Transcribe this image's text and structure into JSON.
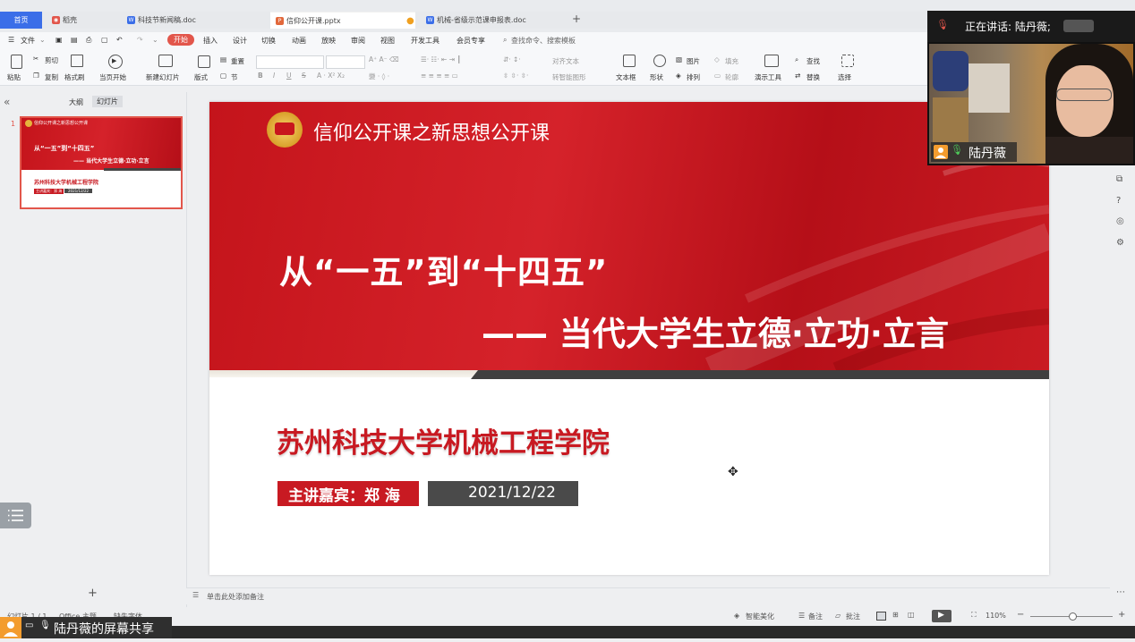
{
  "tabs": {
    "home": "首页",
    "t1": "稻壳",
    "t2": "科技节新闻稿.doc",
    "t3": "信仰公开课.pptx",
    "t4": "机械-省级示范课申报表.doc",
    "add": "+"
  },
  "menu": {
    "file": "文件",
    "items": [
      "开始",
      "插入",
      "设计",
      "切换",
      "动画",
      "放映",
      "审阅",
      "视图",
      "开发工具",
      "会员专享"
    ],
    "search": "查找命令、搜索模板"
  },
  "ribbon": {
    "paste": "粘贴",
    "cut": "剪切",
    "copy": "复制",
    "format_painter": "格式刷",
    "from_start": "当页开始",
    "new_slide": "新建幻灯片",
    "layout": "版式",
    "section": "节",
    "reset": "重置",
    "align_text": "对齐文本",
    "smartart": "转智能图形",
    "textbox": "文本框",
    "shape": "形状",
    "picture": "图片",
    "fill": "填充",
    "arrange": "排列",
    "outline": "轮廓",
    "present_tools": "演示工具",
    "find": "查找",
    "replace": "替换",
    "select": "选择"
  },
  "panel": {
    "collapse": "«",
    "outline_tab": "大纲",
    "slides_tab": "幻灯片",
    "slide_number": "1",
    "add": "+"
  },
  "thumb": {
    "header": "信仰公开课之新思想公开课",
    "title": "从“一五”到“十四五”",
    "subtitle": "—— 当代大学生立德·立功·立言",
    "school": "苏州科技大学机械工程学院",
    "speaker": "主讲嘉宾：郑 海",
    "date": "2021/12/22"
  },
  "slide": {
    "header": "信仰公开课之新思想公开课",
    "title": "从“一五”到“十四五”",
    "subtitle": "—— 当代大学生立德·立功·立言",
    "school": "苏州科技大学机械工程学院",
    "speaker": "主讲嘉宾：郑 海",
    "date": "2021/12/22"
  },
  "notes": {
    "placeholder": "单击此处添加备注"
  },
  "status": {
    "slide_info": "幻灯片 1 / 1",
    "theme": "Office 主题",
    "missing_font": "缺失字体",
    "beautify": "智能美化",
    "notes": "备注",
    "comments": "批注",
    "zoom": "110%",
    "minus": "−",
    "plus": "+"
  },
  "video": {
    "talking": "正在讲话: 陆丹薇;",
    "name": "陆丹薇"
  },
  "share": {
    "label": "陆丹薇的屏幕共享"
  },
  "colors": {
    "accent": "#e2564b",
    "banner_red": "#c8161d",
    "school_red": "#c81a22",
    "date_gray": "#4a4a4a",
    "home_tab": "#3b6ee8"
  }
}
